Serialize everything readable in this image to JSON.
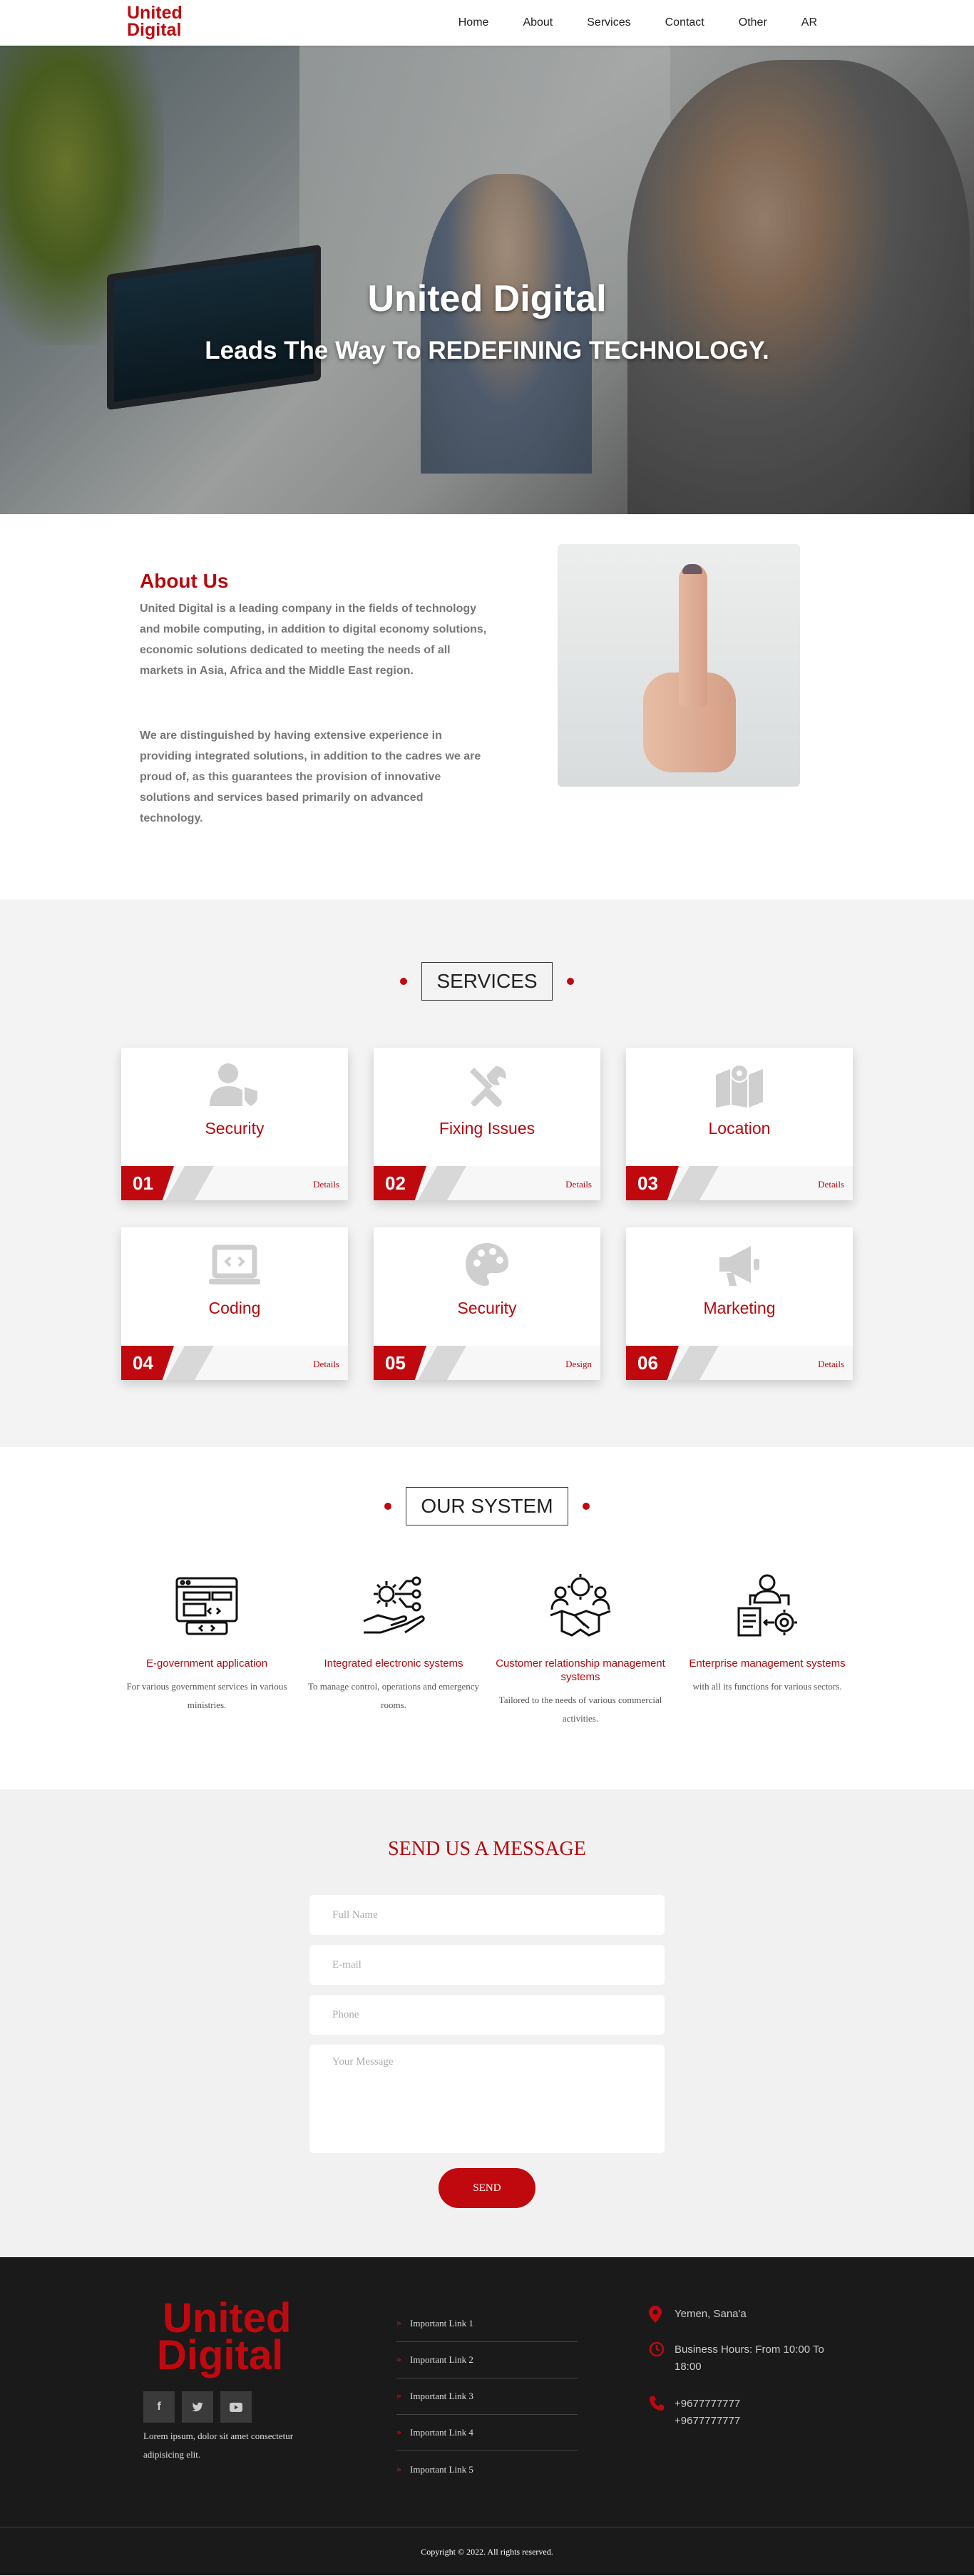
{
  "brand": {
    "line1": "United",
    "line2": "Digital"
  },
  "nav": {
    "items": [
      "Home",
      "About",
      "Services",
      "Contact",
      "Other",
      "AR"
    ]
  },
  "hero": {
    "title": "United Digital",
    "subtitle": "Leads The Way To REDEFINING TECHNOLOGY."
  },
  "about": {
    "title": "About Us",
    "p1": "United Digital is a leading company in the fields of technology and mobile computing, in addition to digital economy solutions, economic solutions dedicated to meeting the needs of all markets in Asia, Africa and the Middle East region.",
    "p2": "We are distinguished by having extensive experience in providing integrated solutions, in addition to the cadres we are proud of, as this guarantees the provision of innovative solutions and services based primarily on advanced technology."
  },
  "services": {
    "heading": "SERVICES",
    "cards": [
      {
        "num": "01",
        "name": "Security",
        "link": "Details",
        "icon": "user-shield-icon"
      },
      {
        "num": "02",
        "name": "Fixing Issues",
        "link": "Details",
        "icon": "tools-icon"
      },
      {
        "num": "03",
        "name": "Location",
        "link": "Details",
        "icon": "map-location-icon"
      },
      {
        "num": "04",
        "name": "Coding",
        "link": "Details",
        "icon": "laptop-code-icon"
      },
      {
        "num": "05",
        "name": "Security",
        "link": "Design",
        "icon": "palette-icon"
      },
      {
        "num": "06",
        "name": "Marketing",
        "link": "Details",
        "icon": "megaphone-icon"
      }
    ]
  },
  "system": {
    "heading": "OUR SYSTEM",
    "items": [
      {
        "title": "E-government application",
        "desc": "For various government services in various ministries.",
        "icon": "web-app-icon"
      },
      {
        "title": "Integrated electronic systems",
        "desc": "To manage control, operations and emergency rooms.",
        "icon": "gear-hand-icon"
      },
      {
        "title": "Customer relationship management systems",
        "desc": "Tailored to the needs of various commercial activities.",
        "icon": "handshake-icon"
      },
      {
        "title": "Enterprise management systems",
        "desc": "with all its functions for various sectors.",
        "icon": "enterprise-icon"
      }
    ]
  },
  "contact": {
    "title": "SEND US A MESSAGE",
    "full_name": "Full Name",
    "email": "E-mail",
    "phone": "Phone",
    "message": "Your Message",
    "send": "SEND"
  },
  "footer": {
    "description": "Lorem ipsum, dolor sit amet consectetur adipisicing elit.",
    "links": [
      "Important Link 1",
      "Important Link 2",
      "Important Link 3",
      "Important Link 4",
      "Important Link 5"
    ],
    "location": "Yemen, Sana'a",
    "hours": "Business Hours: From 10:00 To 18:00",
    "phone1": "+9677777777",
    "phone2": "+9677777777",
    "copyright": "Copyright © 2022. All rights reserved."
  },
  "colors": {
    "accent": "#c0090f",
    "dark": "#1a1a1a",
    "light_bg": "#f3f3f3"
  }
}
